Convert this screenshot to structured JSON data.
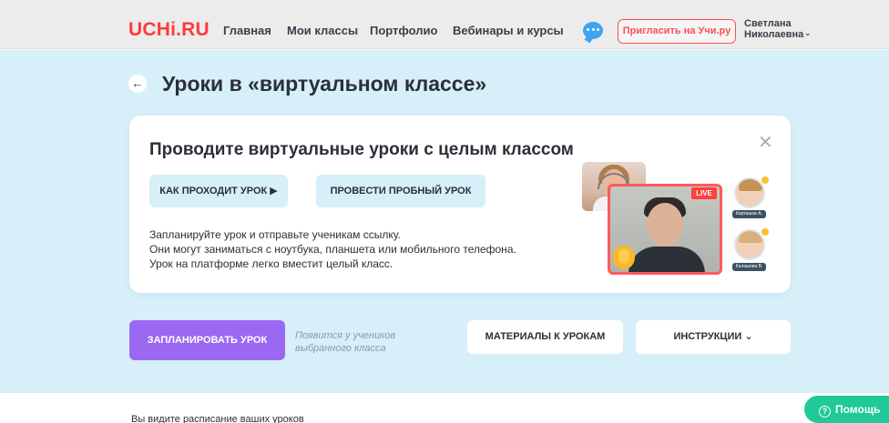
{
  "header": {
    "logo_part1": "UCHi",
    "logo_part2": ".RU",
    "nav": [
      "Главная",
      "Мои классы",
      "Портфолио",
      "Вебинары и курсы"
    ],
    "invite_label": "Пригласить на Учи.ру",
    "user_first": "Светлана",
    "user_last": "Николаевна",
    "chat_icon": "chat-bubble-icon"
  },
  "page": {
    "back_icon": "←",
    "title": "Уроки в «виртуальном классе»"
  },
  "promo": {
    "close_icon": "✕",
    "title": "Проводите виртуальные уроки с целым классом",
    "how_label": "КАК ПРОХОДИТ УРОК ▶",
    "trial_label": "ПРОВЕСТИ ПРОБНЫЙ УРОК",
    "text_lines": [
      "Запланируйте урок и отправьте ученикам ссылку.",
      "Они могут заниматься с ноутбука, планшета или мобильного телефона.",
      "Урок на платформе легко вместит целый класс."
    ],
    "live_label": "LIVE",
    "student_tags": [
      "Карташов А.",
      "Калашова В."
    ]
  },
  "actions": {
    "schedule_label": "ЗАПЛАНИРОВАТЬ УРОК",
    "hint_lines": [
      "Появится у учеников",
      "выбранного класса"
    ],
    "materials_label": "МАТЕРИАЛЫ К УРОКАМ",
    "instructions_label": "ИНСТРУКЦИИ ⌄"
  },
  "footer": {
    "schedule_text": "Вы видите расписание ваших уроков",
    "help_label": "Помощь",
    "help_icon": "?"
  },
  "colors": {
    "brand_red": "#ff3a3a",
    "hero_bg": "#d6eff9",
    "primary_purple": "#9b68f2",
    "help_green": "#20c997",
    "chat_blue": "#3ea5f2"
  }
}
